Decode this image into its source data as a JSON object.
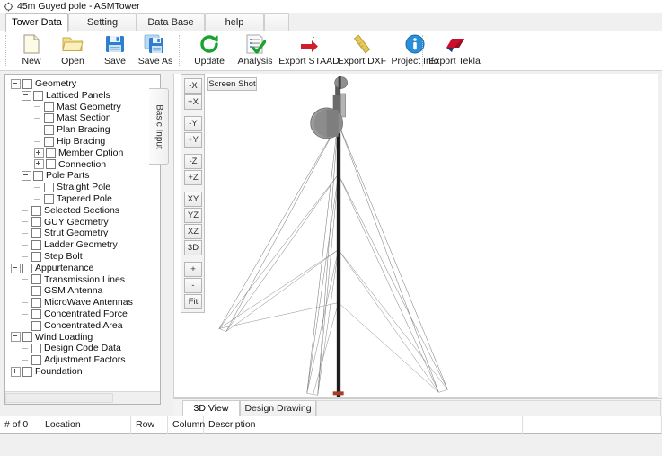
{
  "window": {
    "title": "45m Guyed pole - ASMTower",
    "icon": "compass-icon"
  },
  "tabs": [
    {
      "label": "Tower Data",
      "active": true
    },
    {
      "label": "Setting",
      "active": false
    },
    {
      "label": "Data Base",
      "active": false
    },
    {
      "label": "help",
      "active": false
    }
  ],
  "toolbar": {
    "buttons": [
      {
        "label": "New",
        "icon": "new-file-icon"
      },
      {
        "label": "Open",
        "icon": "open-folder-icon"
      },
      {
        "label": "Save",
        "icon": "floppy-save-icon"
      },
      {
        "label": "Save As",
        "icon": "floppy-save-as-icon"
      },
      {
        "label": "Update",
        "icon": "refresh-icon"
      },
      {
        "label": "Analysis",
        "icon": "checklist-check-icon"
      },
      {
        "label": "Export STAAD",
        "icon": "red-arrow-icon"
      },
      {
        "label": "Export DXF",
        "icon": "gold-ruler-icon"
      },
      {
        "label": "Project Info",
        "icon": "info-circle-icon"
      },
      {
        "label": "Export Tekla",
        "icon": "tekla-red-icon"
      }
    ]
  },
  "side_tab": {
    "label": "Basic Input"
  },
  "tree": {
    "nodes": [
      {
        "label": "Geometry",
        "indent": 0,
        "expander": "minus",
        "checkbox": true
      },
      {
        "label": "Latticed Panels",
        "indent": 1,
        "expander": "minus",
        "checkbox": true
      },
      {
        "label": "Mast Geometry",
        "indent": 2,
        "expander": "leaf",
        "checkbox": true
      },
      {
        "label": "Mast Section",
        "indent": 2,
        "expander": "leaf",
        "checkbox": true
      },
      {
        "label": "Plan Bracing",
        "indent": 2,
        "expander": "leaf",
        "checkbox": true
      },
      {
        "label": "Hip Bracing",
        "indent": 2,
        "expander": "leaf",
        "checkbox": true
      },
      {
        "label": "Member Option",
        "indent": 2,
        "expander": "plus",
        "checkbox": true
      },
      {
        "label": "Connection",
        "indent": 2,
        "expander": "plus",
        "checkbox": true
      },
      {
        "label": "Pole Parts",
        "indent": 1,
        "expander": "minus",
        "checkbox": true
      },
      {
        "label": "Straight Pole",
        "indent": 2,
        "expander": "leaf",
        "checkbox": true
      },
      {
        "label": "Tapered Pole",
        "indent": 2,
        "expander": "leaf",
        "checkbox": true
      },
      {
        "label": "Selected Sections",
        "indent": 1,
        "expander": "leaf",
        "checkbox": true
      },
      {
        "label": "GUY Geometry",
        "indent": 1,
        "expander": "leaf",
        "checkbox": true
      },
      {
        "label": "Strut Geometry",
        "indent": 1,
        "expander": "leaf",
        "checkbox": true
      },
      {
        "label": "Ladder Geometry",
        "indent": 1,
        "expander": "leaf",
        "checkbox": true
      },
      {
        "label": "Step Bolt",
        "indent": 1,
        "expander": "leaf",
        "checkbox": true
      },
      {
        "label": "Appurtenance",
        "indent": 0,
        "expander": "minus",
        "checkbox": true
      },
      {
        "label": "Transmission Lines",
        "indent": 1,
        "expander": "leaf",
        "checkbox": true
      },
      {
        "label": "GSM Antenna",
        "indent": 1,
        "expander": "leaf",
        "checkbox": true
      },
      {
        "label": "MicroWave Antennas",
        "indent": 1,
        "expander": "leaf",
        "checkbox": true
      },
      {
        "label": "Concentrated Force",
        "indent": 1,
        "expander": "leaf",
        "checkbox": true
      },
      {
        "label": "Concentrated Area",
        "indent": 1,
        "expander": "leaf",
        "checkbox": true
      },
      {
        "label": "Wind Loading",
        "indent": 0,
        "expander": "minus",
        "checkbox": true
      },
      {
        "label": "Design Code Data",
        "indent": 1,
        "expander": "leaf",
        "checkbox": true
      },
      {
        "label": "Adjustment Factors",
        "indent": 1,
        "expander": "leaf",
        "checkbox": true
      },
      {
        "label": "Foundation",
        "indent": 0,
        "expander": "plus",
        "checkbox": true
      }
    ]
  },
  "view_controls": {
    "screen_shot_label": "Screen Shot",
    "buttons": [
      {
        "label": "-X"
      },
      {
        "label": "+X"
      },
      {
        "label": "-Y"
      },
      {
        "label": "+Y"
      },
      {
        "label": "-Z"
      },
      {
        "label": "+Z"
      },
      {
        "label": "XY"
      },
      {
        "label": "YZ"
      },
      {
        "label": "XZ"
      },
      {
        "label": "3D"
      },
      {
        "label": "+"
      },
      {
        "label": "-"
      },
      {
        "label": "Fit"
      }
    ]
  },
  "view_tabs": [
    {
      "label": "3D View",
      "active": true
    },
    {
      "label": "Design Drawing",
      "active": false
    }
  ],
  "status_grid": {
    "columns": [
      "# of 0",
      "Location",
      "Row",
      "Column",
      "Description",
      ""
    ]
  },
  "colors": {
    "accent_red": "#c8102e",
    "accent_blue": "#1c7cd6",
    "accent_green": "#1aa431",
    "accent_gold": "#d9b44a",
    "panel_bg": "#f0f0f0",
    "canvas_bg": "#ffffff"
  }
}
